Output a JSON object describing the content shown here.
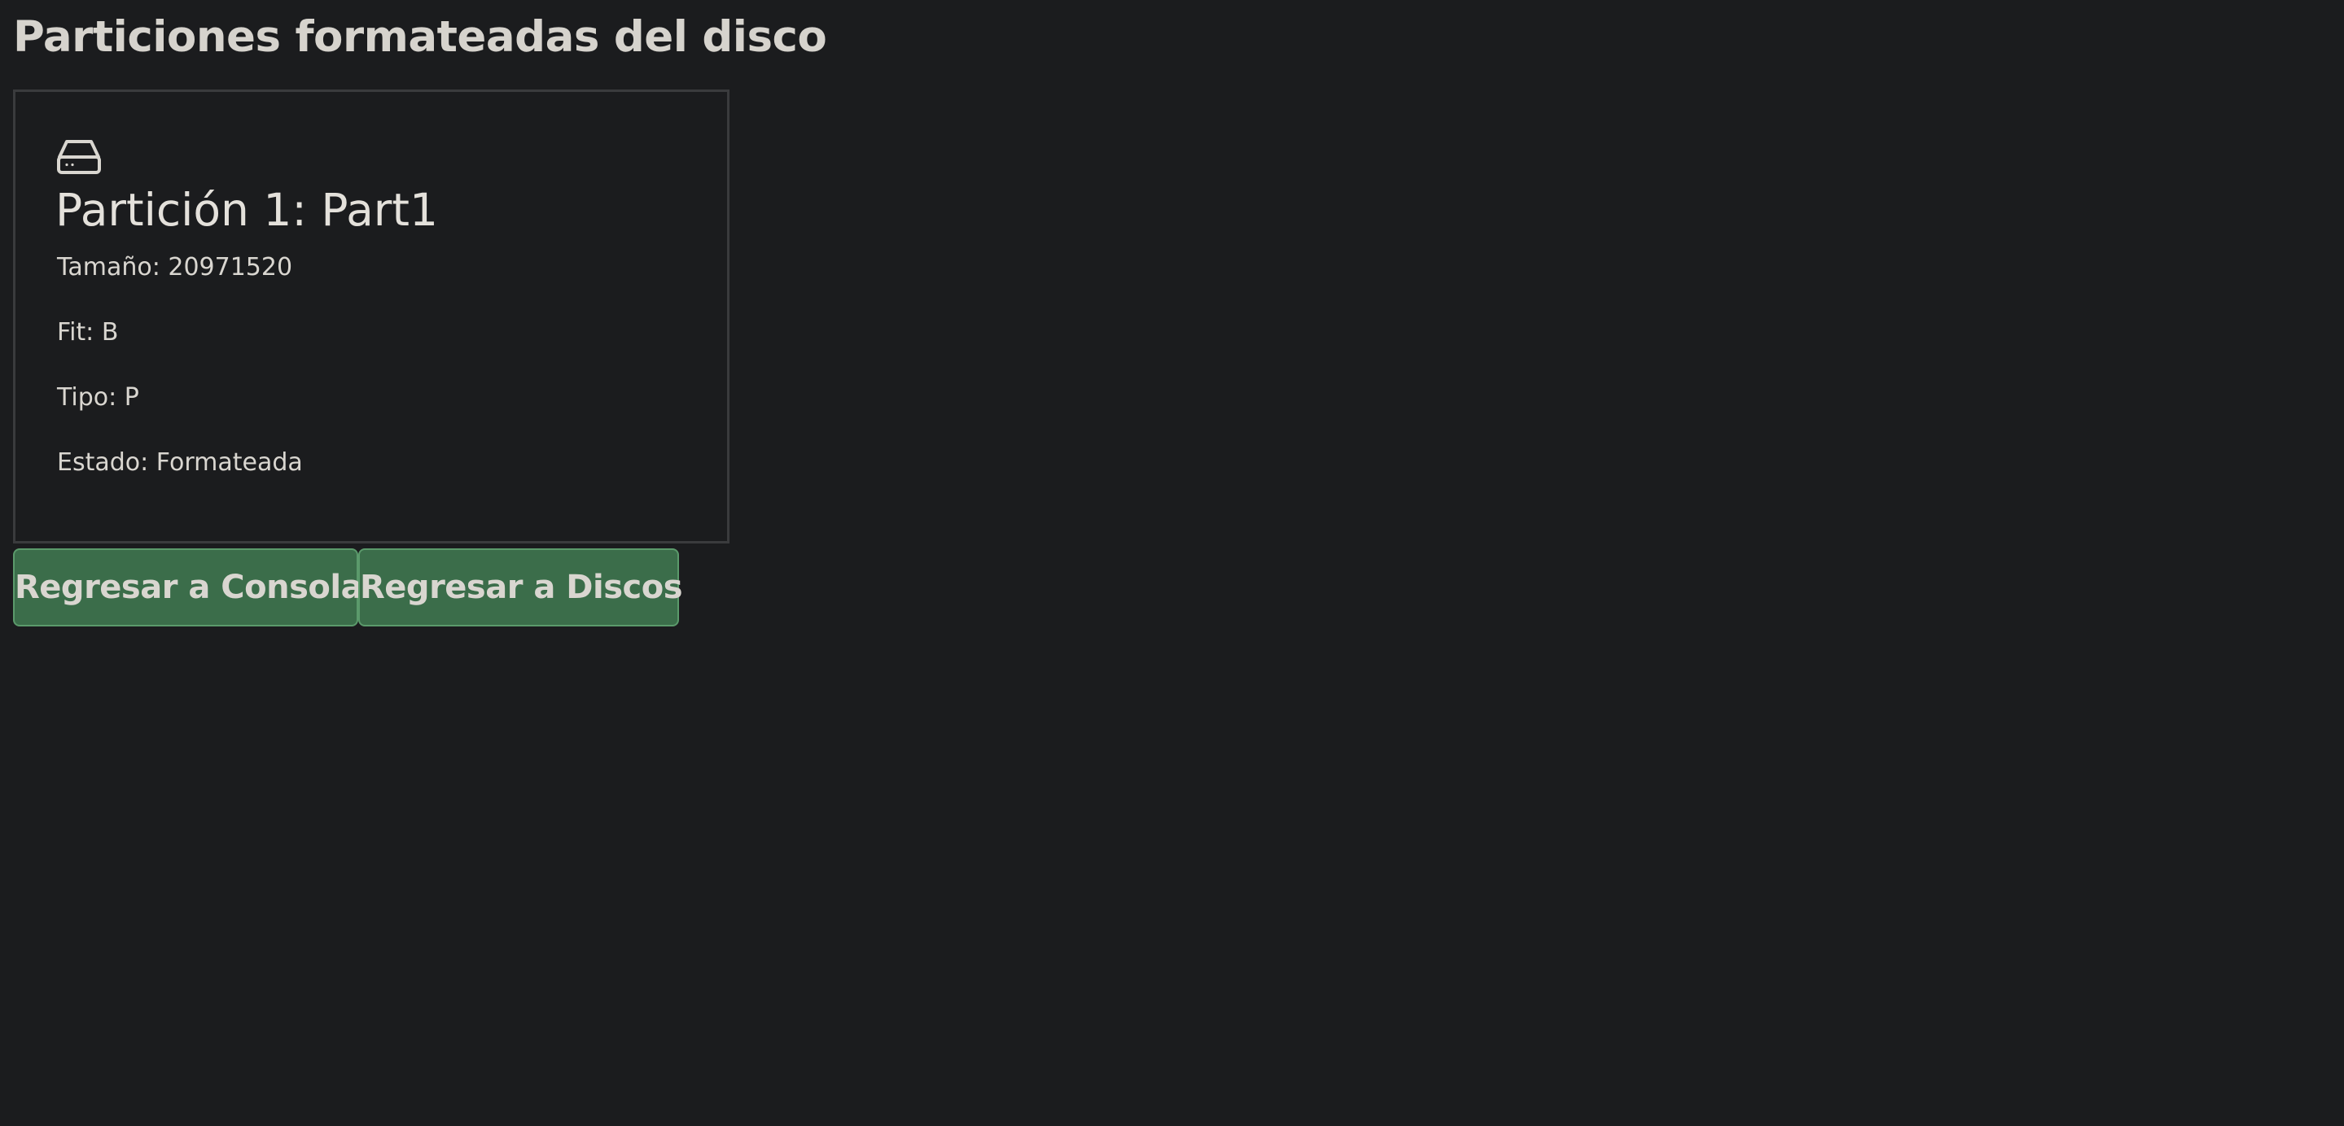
{
  "page": {
    "title": "Particiones formateadas del disco"
  },
  "partition": {
    "icon": "hard-drive-icon",
    "title": "Partición 1: Part1",
    "size": "Tamaño: 20971520",
    "fit": "Fit: B",
    "type": "Tipo: P",
    "status": "Estado: Formateada"
  },
  "actions": {
    "back_console_label": "Regresar a Consola",
    "back_disks_label": "Regresar a Discos"
  },
  "colors": {
    "background": "#1b1c1e",
    "text": "#d9d6d0",
    "card_border": "#3a3b3d",
    "button_bg": "#3b6d4a",
    "button_border": "#5b9a6b"
  }
}
